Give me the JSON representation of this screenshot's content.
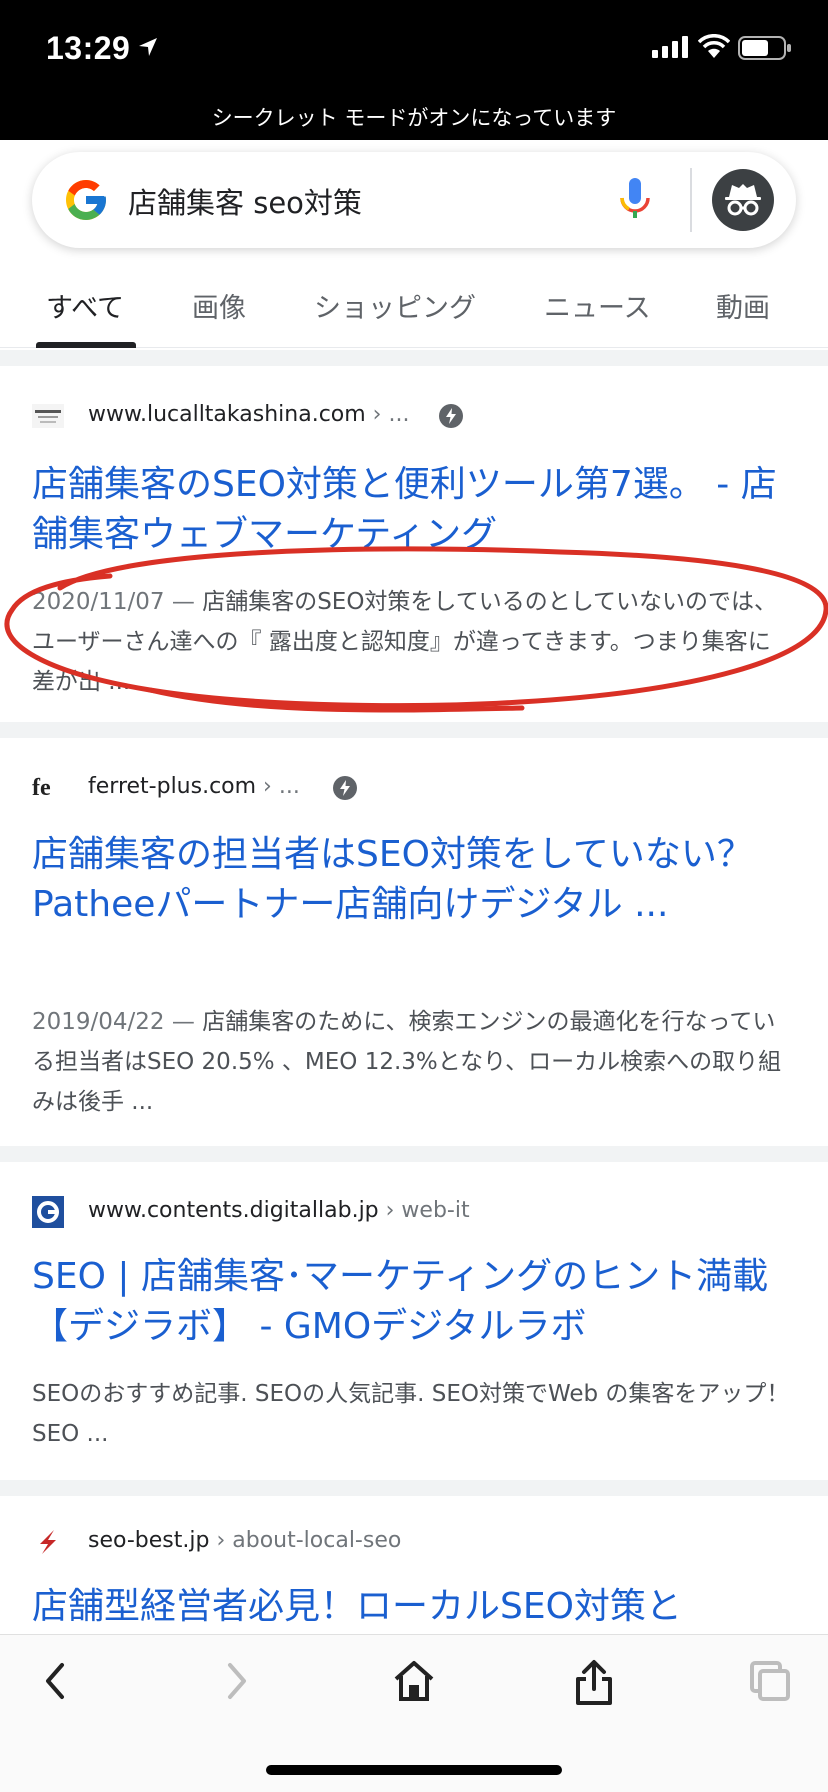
{
  "status_bar": {
    "time": "13:29"
  },
  "incognito_banner": "シークレット モードがオンになっています",
  "search": {
    "query": "店舗集客 seo対策"
  },
  "tabs": [
    {
      "label": "すべて",
      "active": true
    },
    {
      "label": "画像"
    },
    {
      "label": "ショッピング"
    },
    {
      "label": "ニュース"
    },
    {
      "label": "動画"
    }
  ],
  "results": [
    {
      "domain": "www.lucalltakashina.com",
      "path": " › ...",
      "title": "店舗集客のSEO対策と便利ツール第7選。 - 店舗集客ウェブマーケティング",
      "date": "2020/11/07 — ",
      "snippet": "店舗集客のSEO対策をしているのとしていないのでは、ユーザーさん達への『 露出度と認知度』が違ってきます。つまり集客に差が出 ..."
    },
    {
      "domain": "ferret-plus.com",
      "path": " › ...",
      "favicon_text": "fe",
      "title": "店舗集客の担当者はSEO対策をしていない？ Patheeパートナー店舗向けデジタル ...",
      "date": "2019/04/22 — ",
      "snippet": "店舗集客のために、検索エンジンの最適化を行なっている担当者はSEO 20.5% 、MEO 12.3%となり、ローカル検索への取り組みは後手 ..."
    },
    {
      "domain": "www.contents.digitallab.jp",
      "path": " › web-it",
      "title": "SEO | 店舗集客･マーケティングのヒント満載【デジラボ】 - GMOデジタルラボ",
      "snippet": "SEOのおすすめ記事. SEOの人気記事. SEO対策でWeb の集客をアップ！SEO ..."
    },
    {
      "domain": "seo-best.jp",
      "path": " › about-local-seo",
      "title": "店舗型経営者必見！ローカルSEO対策と"
    }
  ],
  "colors": {
    "link": "#1a5fd0",
    "annotation": "#d93025"
  }
}
